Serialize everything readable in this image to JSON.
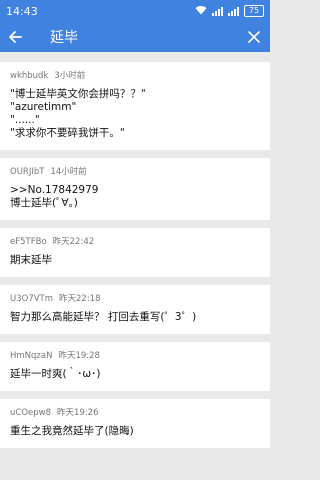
{
  "status_bar": {
    "time": "14:43",
    "battery": "75"
  },
  "app_bar": {
    "title": "延毕"
  },
  "posts": [
    {
      "user": "wkhbudk",
      "time": "3小时前",
      "lines": [
        "\"博士延毕英文你会拼吗？？\"",
        "\"azuretimm\"",
        "\"......\"",
        "\"求求你不要碎我饼干。\""
      ]
    },
    {
      "user": "OURJIbT",
      "time": "14小时前",
      "lines": [
        ">>No.17842979",
        "博士延毕(ﾟ∀。)"
      ]
    },
    {
      "user": "eF5TFBo",
      "time": "昨天22:42",
      "lines": [
        "期末延毕"
      ]
    },
    {
      "user": "U3O7VTm",
      "time": "昨天22:18",
      "lines": [
        "智力那么高能延毕？ 打回去重写(゜3゜)"
      ]
    },
    {
      "user": "HmNqzaN",
      "time": "昨天19:28",
      "lines": [
        "延毕一时爽(｀･ω･)"
      ]
    },
    {
      "user": "uCOepw8",
      "time": "昨天19:26",
      "lines": [
        "重生之我竟然延毕了(隐晦)"
      ]
    }
  ]
}
